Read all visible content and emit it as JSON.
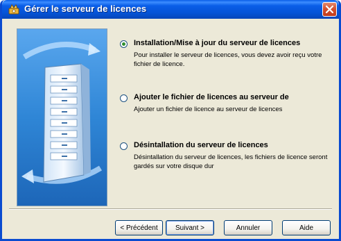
{
  "window": {
    "title": "Gérer le serveur de licences",
    "icon": "key-tool-icon",
    "close_icon": "close-icon"
  },
  "options": [
    {
      "title": "Installation/Mise à jour du serveur de licences",
      "description": "Pour installer le serveur de licences, vous devez avoir reçu votre fichier de licence.",
      "checked": true
    },
    {
      "title": "Ajouter le fichier de licences au serveur de",
      "description": "Ajouter un fichier de licence au serveur de licences",
      "checked": false
    },
    {
      "title": "Désintallation du serveur de licences",
      "description": "Désintallation du serveur de licences, les fichiers de licence seront gardés sur votre disque dur",
      "checked": false
    }
  ],
  "buttons": {
    "previous": "< Précédent",
    "next": "Suivant >",
    "cancel": "Annuler",
    "help": "Aide"
  },
  "colors": {
    "titlebar": "#0a5ee8",
    "dialog_bg": "#ece9d8",
    "illustration_bg": "#2f86d6"
  }
}
